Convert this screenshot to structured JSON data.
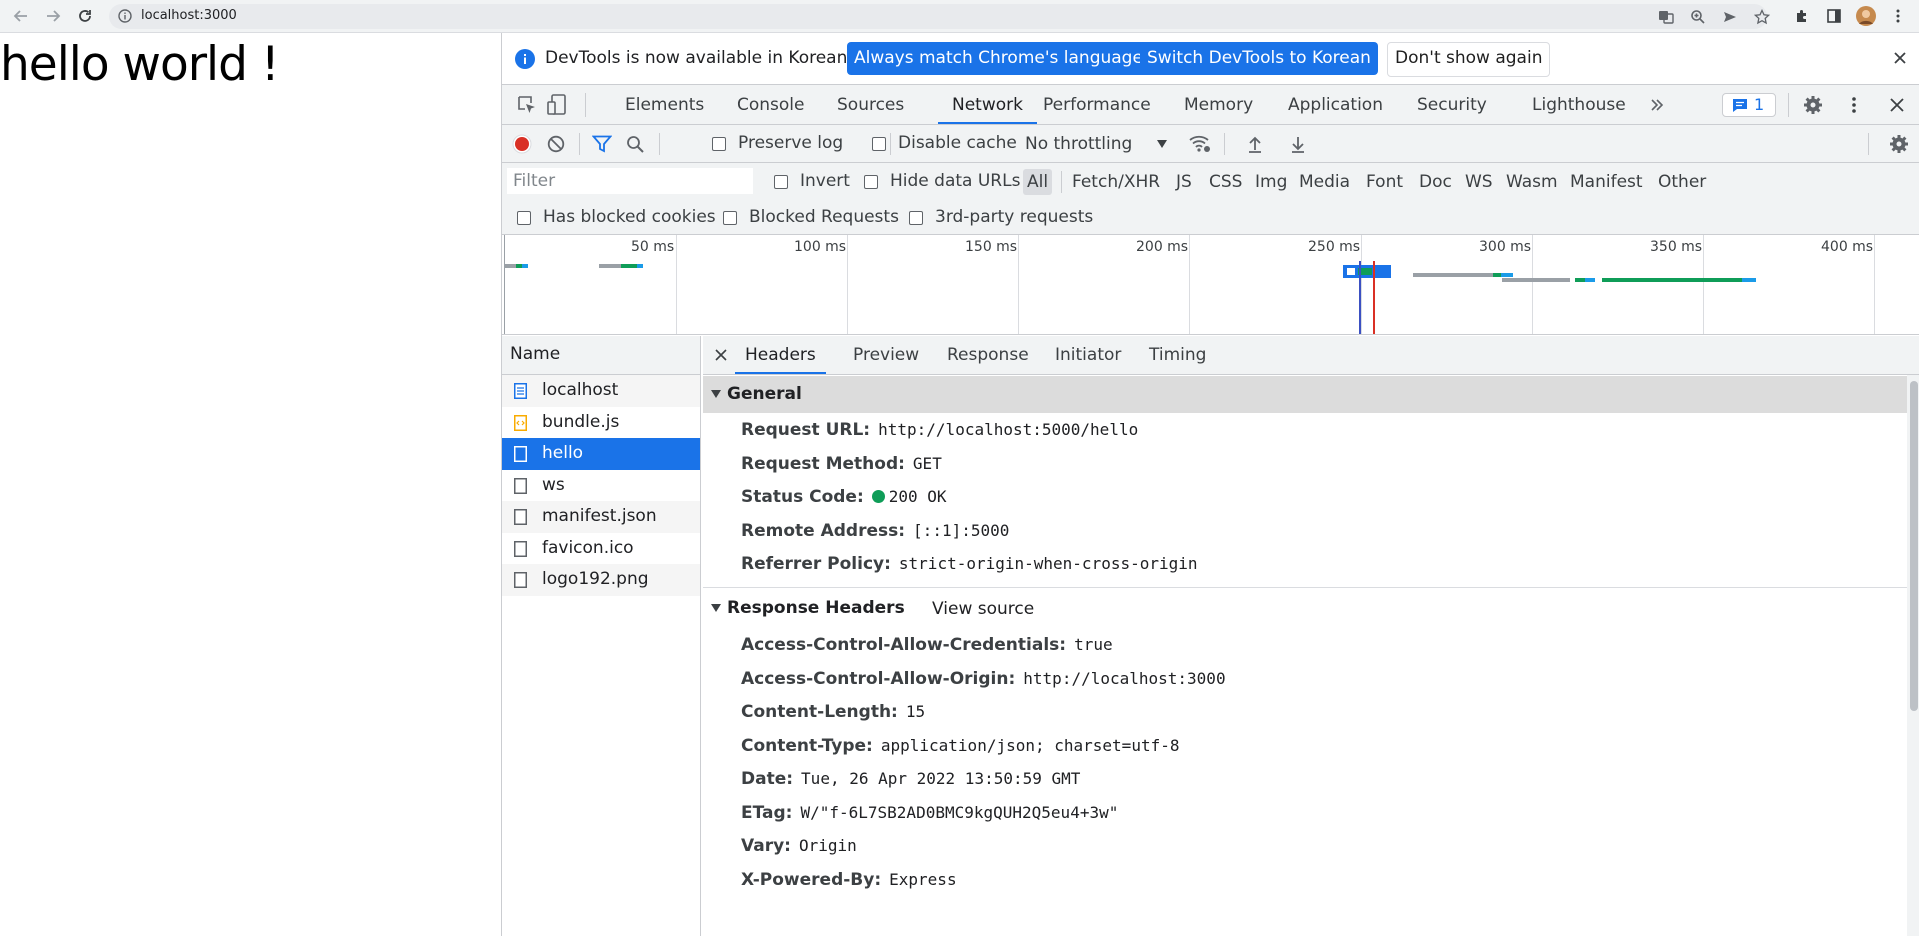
{
  "browser": {
    "url": "localhost:3000"
  },
  "page": {
    "heading": "hello world !"
  },
  "devtools": {
    "infobar": {
      "message": "DevTools is now available in Korean!",
      "match_button": "Always match Chrome's language",
      "switch_button": "Switch DevTools to Korean",
      "dismiss_button": "Don't show again"
    },
    "tabs": [
      "Elements",
      "Console",
      "Sources",
      "Network",
      "Performance",
      "Memory",
      "Application",
      "Security",
      "Lighthouse"
    ],
    "active_tab": "Network",
    "issues_count": "1",
    "network_toolbar": {
      "preserve_log": "Preserve log",
      "disable_cache": "Disable cache",
      "throttling": "No throttling"
    },
    "filter": {
      "placeholder": "Filter",
      "invert": "Invert",
      "hide_data_urls": "Hide data URLs",
      "types": [
        "All",
        "Fetch/XHR",
        "JS",
        "CSS",
        "Img",
        "Media",
        "Font",
        "Doc",
        "WS",
        "Wasm",
        "Manifest",
        "Other"
      ],
      "has_blocked_cookies": "Has blocked cookies",
      "blocked_requests": "Blocked Requests",
      "third_party": "3rd-party requests"
    },
    "overview": {
      "ticks": [
        "50 ms",
        "100 ms",
        "150 ms",
        "200 ms",
        "250 ms",
        "300 ms",
        "350 ms",
        "400 ms"
      ]
    },
    "request_list": {
      "header": "Name",
      "requests": [
        "localhost",
        "bundle.js",
        "hello",
        "ws",
        "manifest.json",
        "favicon.ico",
        "logo192.png"
      ],
      "selected": "hello"
    },
    "detail": {
      "tabs": [
        "Headers",
        "Preview",
        "Response",
        "Initiator",
        "Timing"
      ],
      "general": {
        "title": "General",
        "rows": [
          {
            "key": "Request URL:",
            "value": "http://localhost:5000/hello"
          },
          {
            "key": "Request Method:",
            "value": "GET"
          },
          {
            "key": "Status Code:",
            "value": "200 OK"
          },
          {
            "key": "Remote Address:",
            "value": "[::1]:5000"
          },
          {
            "key": "Referrer Policy:",
            "value": "strict-origin-when-cross-origin"
          }
        ]
      },
      "response_headers": {
        "title": "Response Headers",
        "view_source": "View source",
        "rows": [
          {
            "key": "Access-Control-Allow-Credentials:",
            "value": "true"
          },
          {
            "key": "Access-Control-Allow-Origin:",
            "value": "http://localhost:3000"
          },
          {
            "key": "Content-Length:",
            "value": "15"
          },
          {
            "key": "Content-Type:",
            "value": "application/json; charset=utf-8"
          },
          {
            "key": "Date:",
            "value": "Tue, 26 Apr 2022 13:50:59 GMT"
          },
          {
            "key": "ETag:",
            "value": "W/\"f-6L7SB2AD0BMC9kgQUH2Q5eu4+3w\""
          },
          {
            "key": "Vary:",
            "value": "Origin"
          },
          {
            "key": "X-Powered-By:",
            "value": "Express"
          }
        ]
      }
    }
  },
  "colors": {
    "accent": "#1a73e8",
    "record": "#d93025",
    "status_ok": "#0f9d58"
  }
}
